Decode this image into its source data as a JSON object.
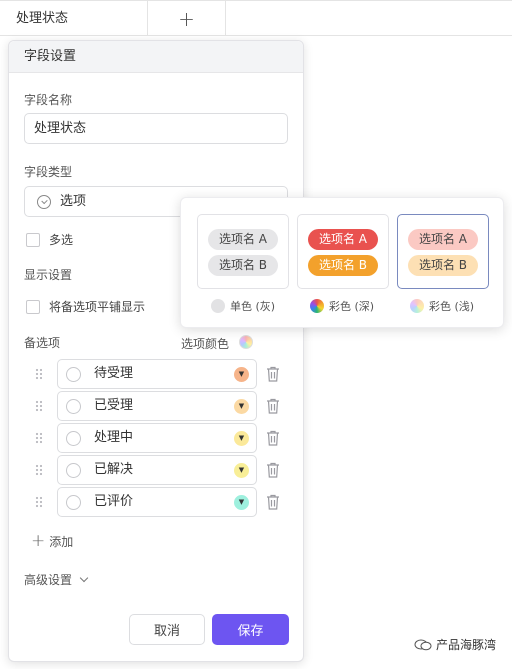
{
  "header": {
    "column_title": "处理状态",
    "add_column": "+"
  },
  "panel": {
    "title": "字段设置",
    "field_name_label": "字段名称",
    "field_name_value": "处理状态",
    "field_type_label": "字段类型",
    "field_type_value": "选项",
    "multi_select_label": "多选",
    "display_settings_label": "显示设置",
    "tile_display_label": "将备选项平铺显示",
    "options_label": "备选项",
    "option_color_label": "选项颜色",
    "options": [
      {
        "label": "待受理",
        "color": "#f6b48a"
      },
      {
        "label": "已受理",
        "color": "#fbd9a3"
      },
      {
        "label": "处理中",
        "color": "#fbe99a"
      },
      {
        "label": "已解决",
        "color": "#f8ee97"
      },
      {
        "label": "已评价",
        "color": "#9ef0de"
      }
    ],
    "add_label": "添加",
    "advanced_label": "高级设置",
    "cancel_label": "取消",
    "save_label": "保存"
  },
  "color_styles": [
    {
      "caption": "单色 (灰)",
      "selected": false,
      "tag_a": "选项名 A",
      "tag_b": "选项名 B",
      "tag_bg_a": "#e6e6e8",
      "tag_bg_b": "#e6e6e8",
      "tag_fg": "#444444"
    },
    {
      "caption": "彩色 (深)",
      "selected": false,
      "tag_a": "选项名 A",
      "tag_b": "选项名 B",
      "tag_bg_a": "#e9524f",
      "tag_bg_b": "#f3a12c",
      "tag_fg": "#ffffff"
    },
    {
      "caption": "彩色 (浅)",
      "selected": true,
      "tag_a": "选项名 A",
      "tag_b": "选项名 B",
      "tag_bg_a": "#fbc9c3",
      "tag_bg_b": "#fde0b4",
      "tag_fg": "#444444"
    }
  ],
  "watermark": {
    "text": "产品海豚湾"
  },
  "colors": {
    "accent": "#6d55f1"
  }
}
